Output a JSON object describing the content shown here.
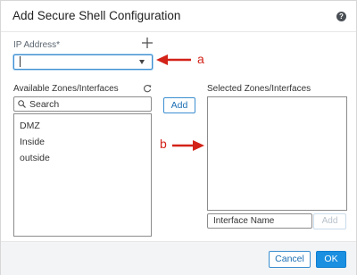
{
  "dialog": {
    "title": "Add Secure Shell Configuration",
    "help_icon": "question-circle-icon",
    "help_glyph": "?"
  },
  "ip_address": {
    "label": "IP Address*",
    "value": "",
    "add_icon": "plus-icon"
  },
  "available": {
    "label": "Available Zones/Interfaces",
    "refresh_icon": "refresh-icon",
    "search_placeholder": "Search",
    "items": [
      "DMZ",
      "Inside",
      "outside"
    ]
  },
  "add_button": "Add",
  "selected": {
    "label": "Selected Zones/Interfaces",
    "items": [],
    "interface_name_placeholder": "Interface Name",
    "interface_add_button": "Add"
  },
  "annotations": {
    "a": "a",
    "b": "b",
    "color": "#d32218"
  },
  "footer": {
    "cancel": "Cancel",
    "ok": "OK"
  },
  "colors": {
    "accent": "#1b8fe0",
    "link": "#1c6fb4"
  }
}
